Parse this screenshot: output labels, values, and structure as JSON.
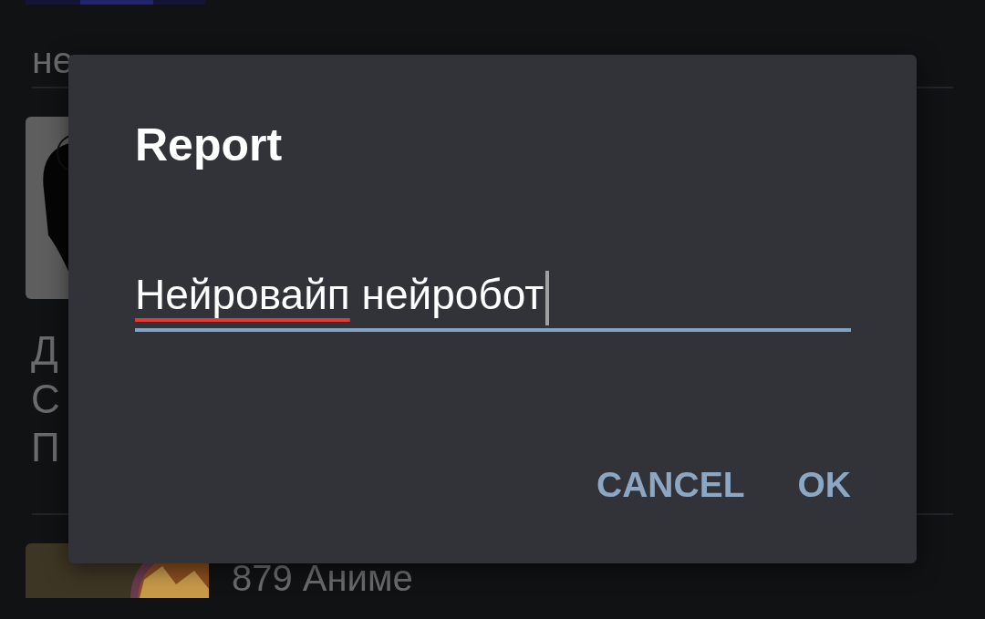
{
  "feed": {
    "items": [
      {
        "kind": "caption",
        "text": "не"
      },
      {
        "kind": "post",
        "lines": [
          "Д",
          "С",
          "П"
        ]
      },
      {
        "kind": "thumb",
        "text": "879 Аниме"
      }
    ]
  },
  "dialog": {
    "title": "Report",
    "field": {
      "focused": true,
      "words": [
        {
          "text": "Нейровайп",
          "misspelled": true
        },
        {
          "text": "нейробот",
          "misspelled": false
        }
      ]
    },
    "buttons": [
      "CANCEL",
      "OK"
    ]
  }
}
